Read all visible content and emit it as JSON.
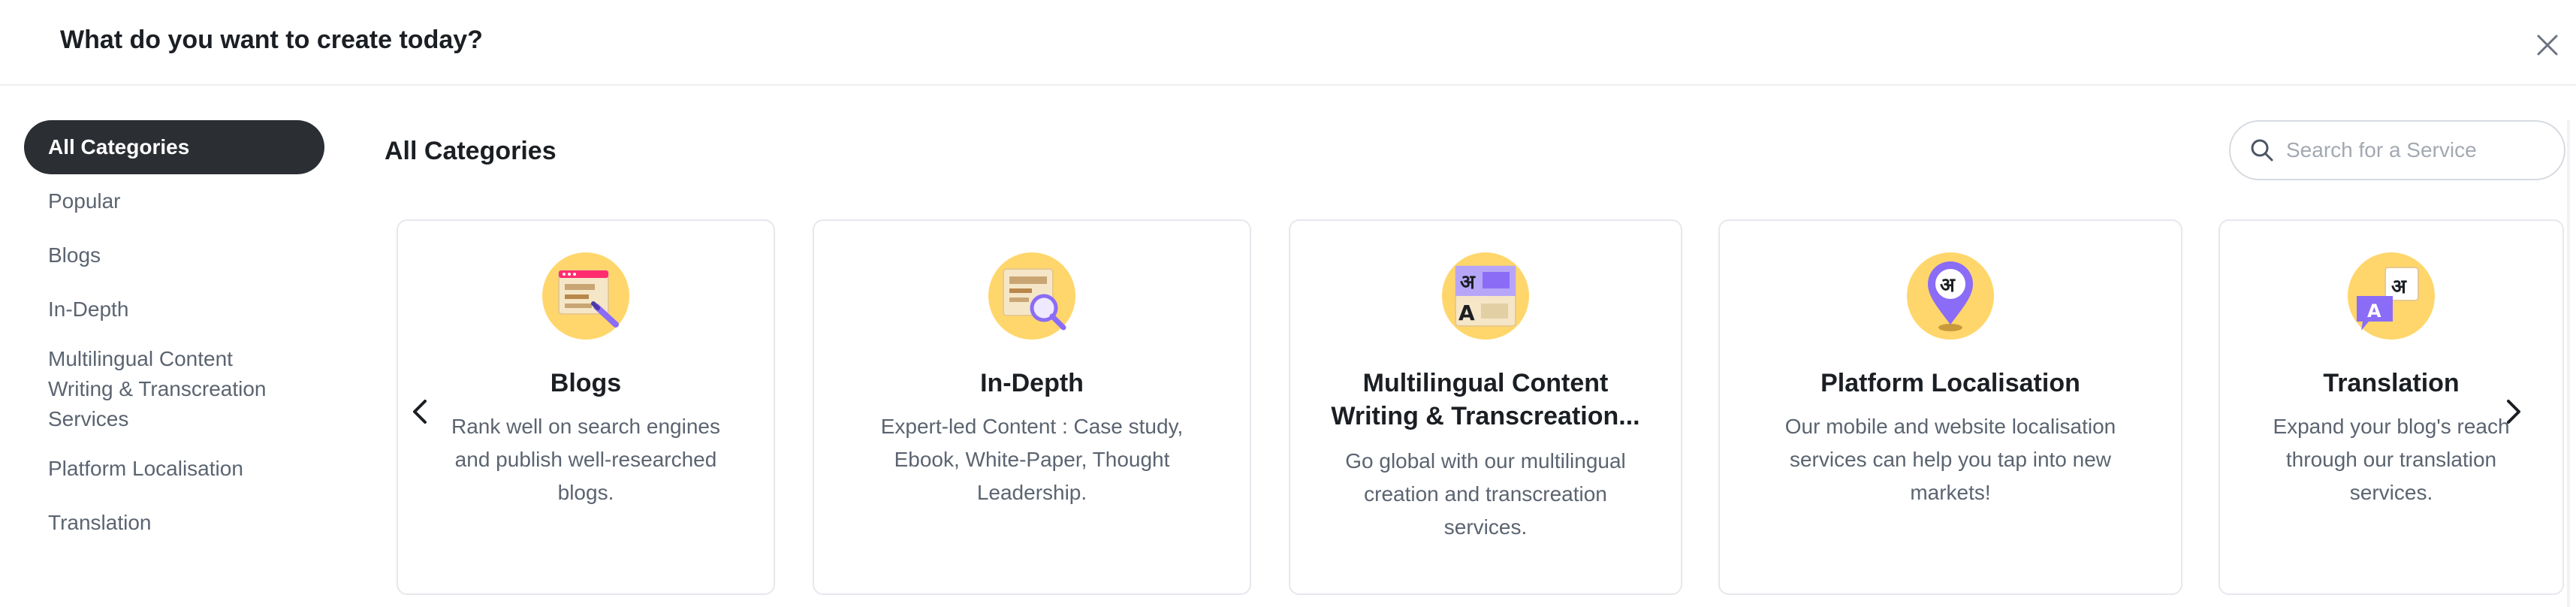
{
  "header": {
    "title": "What do you want to create today?"
  },
  "sidebar": {
    "items": [
      {
        "label": "All Categories",
        "active": true
      },
      {
        "label": "Popular"
      },
      {
        "label": "Blogs"
      },
      {
        "label": "In-Depth"
      },
      {
        "label": "Multilingual Content Writing & Transcreation Services"
      },
      {
        "label": "Platform Localisation"
      },
      {
        "label": "Translation"
      }
    ]
  },
  "main": {
    "title": "All Categories",
    "search": {
      "placeholder": "Search for a Service",
      "value": ""
    },
    "cards": [
      {
        "title": "Blogs",
        "description": "Rank well on search engines and publish well-researched blogs.",
        "icon": "blog-icon"
      },
      {
        "title": "In-Depth",
        "description": "Expert-led Content : Case study, Ebook, White-Paper, Thought Leadership.",
        "icon": "in-depth-icon"
      },
      {
        "title": "Multilingual Content Writing & Transcreation...",
        "description": "Go global with our multilingual creation and transcreation services.",
        "icon": "multilingual-icon"
      },
      {
        "title": "Platform Localisation",
        "description": "Our mobile and website localisation services can help you tap into new markets!",
        "icon": "location-pin-icon"
      },
      {
        "title": "Translation",
        "description": "Expand your blog's reach through our translation services.",
        "icon": "translation-icon"
      }
    ],
    "glyphs": {
      "hindi": "अ",
      "latin": "A"
    }
  },
  "colors": {
    "icon_circle": "#ffd66b",
    "accent_purple": "#8b6cf6",
    "active_pill": "#2b2e33",
    "blog_pink": "#ff2d6f"
  }
}
